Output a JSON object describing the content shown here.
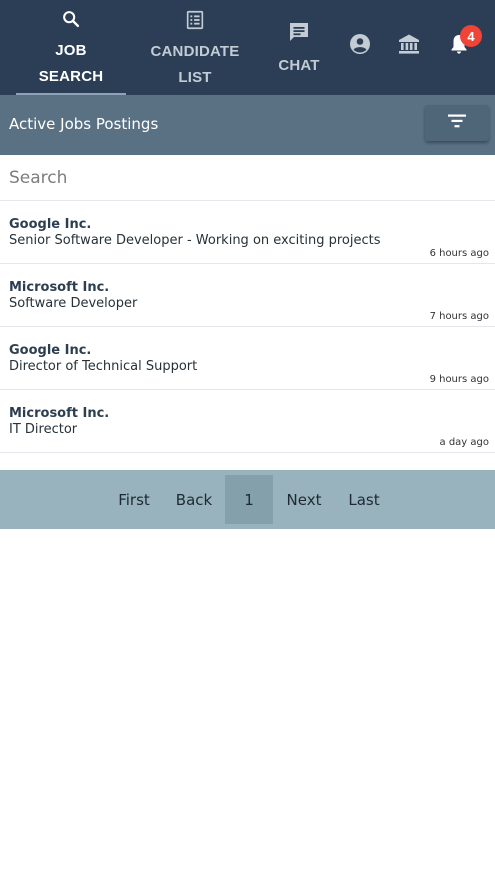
{
  "nav": {
    "tabs": [
      {
        "line1": "JOB",
        "line2": "SEARCH",
        "icon": "search-icon"
      },
      {
        "line1": "CANDIDATE",
        "line2": "LIST",
        "icon": "list-icon"
      },
      {
        "line1": "CHAT",
        "icon": "chat-icon"
      }
    ],
    "icons": [
      "account-circle-icon",
      "bank-icon",
      "bell-icon"
    ],
    "notification_count": "4"
  },
  "subheader": {
    "title": "Active Jobs Postings",
    "filter_icon": "filter-icon"
  },
  "search": {
    "placeholder": "Search"
  },
  "jobs": [
    {
      "company": "Google Inc.",
      "title": "Senior Software Developer - Working on exciting projects",
      "time": "6 hours ago"
    },
    {
      "company": "Microsoft Inc.",
      "title": "Software Developer",
      "time": "7 hours ago"
    },
    {
      "company": "Google Inc.",
      "title": "Director of Technical Support",
      "time": "9 hours ago"
    },
    {
      "company": "Microsoft Inc.",
      "title": "IT Director",
      "time": "a day ago"
    }
  ],
  "pagination": {
    "first": "First",
    "back": "Back",
    "current": "1",
    "next": "Next",
    "last": "Last"
  },
  "colors": {
    "nav_bg": "#2b3e55",
    "subheader_bg": "#5a7184",
    "pagination_bg": "#98b3bd",
    "badge": "#f04438"
  }
}
